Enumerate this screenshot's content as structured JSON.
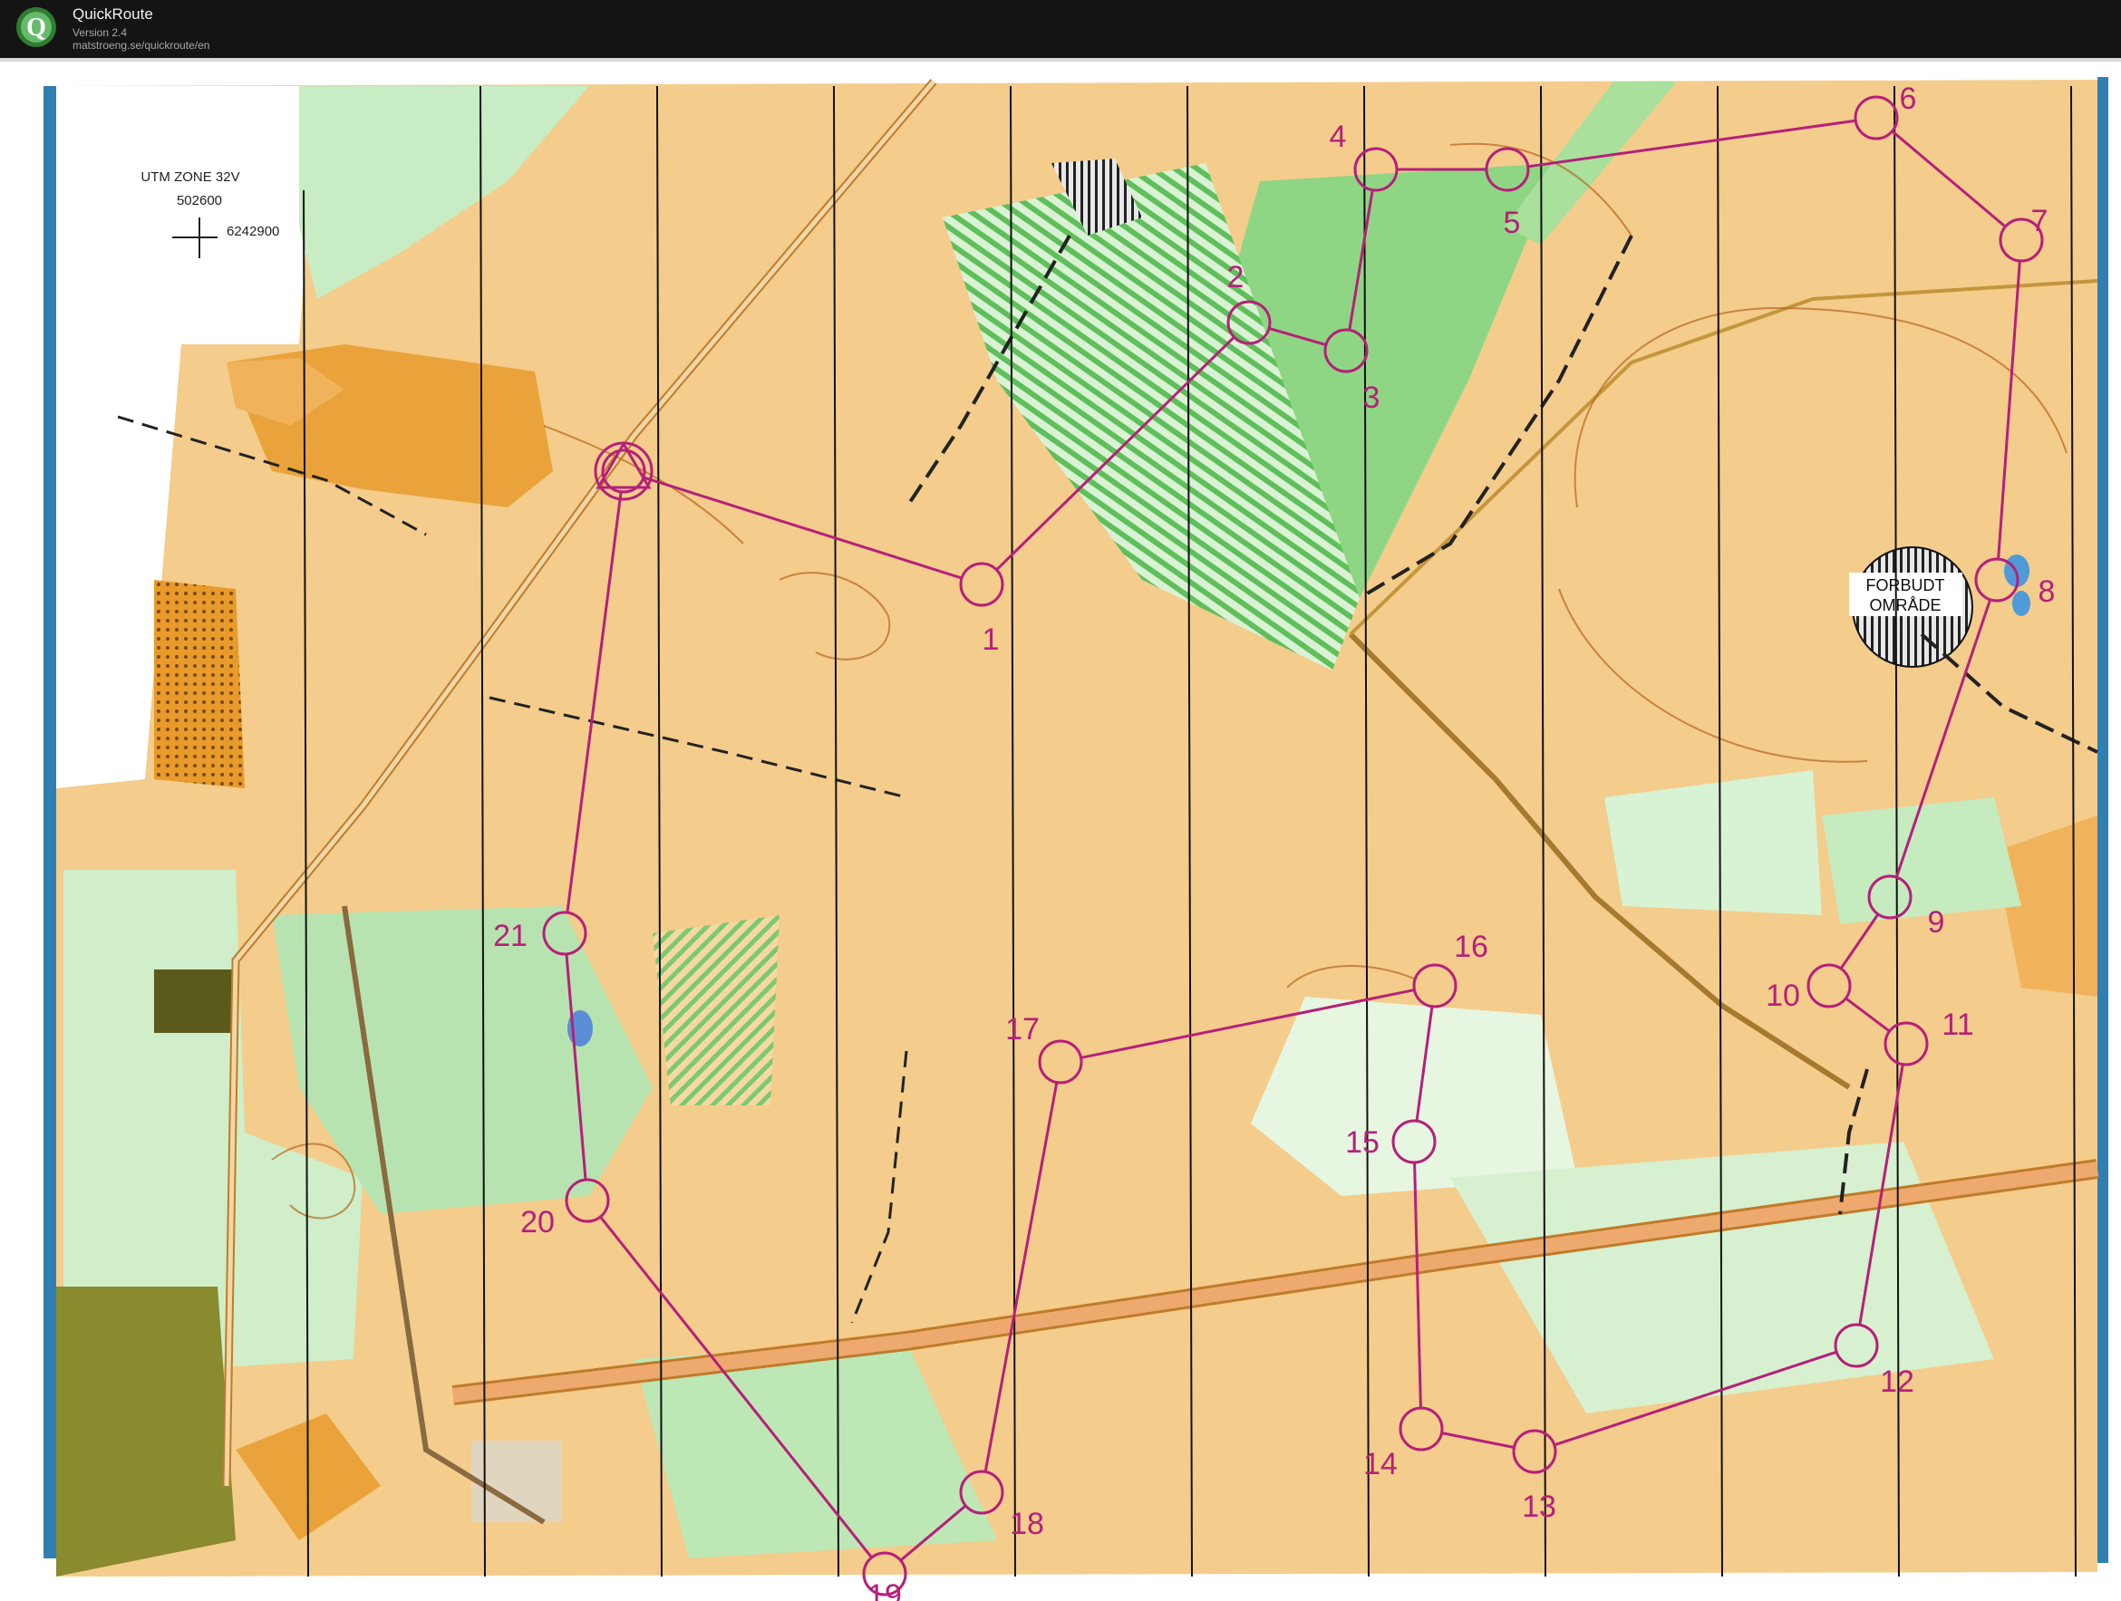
{
  "app": {
    "title": "QuickRoute",
    "version": "Version 2.4",
    "url": "matstroeng.se/quickroute/en",
    "logo_letter": "Q"
  },
  "map": {
    "zone_label": "UTM ZONE 32V",
    "easting": "502600",
    "northing": "6242900",
    "forbidden_line1": "FORBUDT",
    "forbidden_line2": "OMRÅDE",
    "course_color": "#b5207a",
    "controls": [
      {
        "num": "1"
      },
      {
        "num": "2"
      },
      {
        "num": "3"
      },
      {
        "num": "4"
      },
      {
        "num": "5"
      },
      {
        "num": "6"
      },
      {
        "num": "7"
      },
      {
        "num": "8"
      },
      {
        "num": "9"
      },
      {
        "num": "10"
      },
      {
        "num": "11"
      },
      {
        "num": "12"
      },
      {
        "num": "13"
      },
      {
        "num": "14"
      },
      {
        "num": "15"
      },
      {
        "num": "16"
      },
      {
        "num": "17"
      },
      {
        "num": "18"
      },
      {
        "num": "19"
      },
      {
        "num": "20"
      },
      {
        "num": "21"
      }
    ]
  }
}
